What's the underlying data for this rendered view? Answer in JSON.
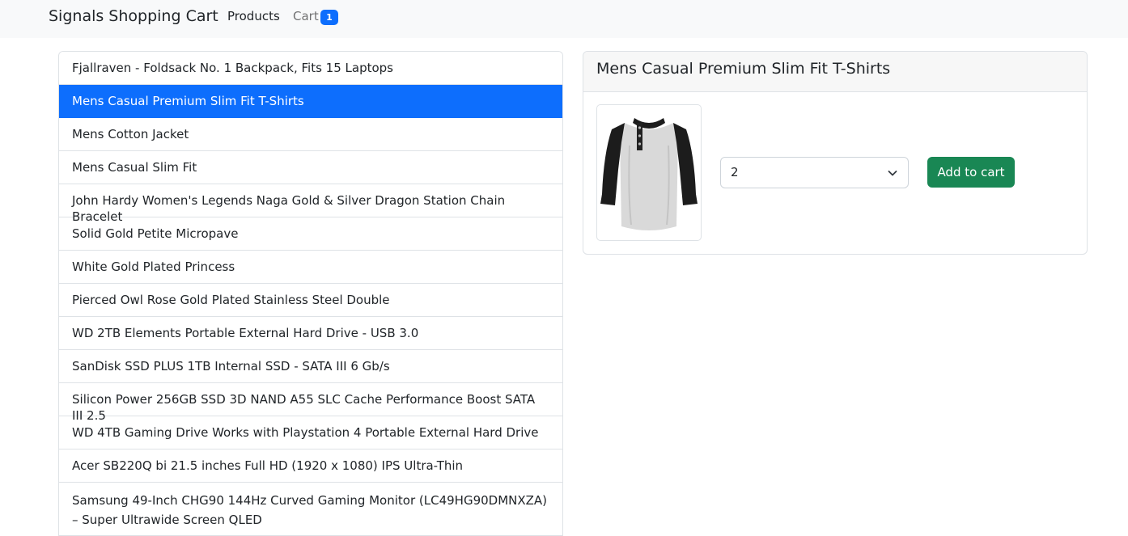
{
  "navbar": {
    "brand": "Signals Shopping Cart",
    "products_label": "Products",
    "cart_label": "Cart",
    "cart_count": "1"
  },
  "products": [
    {
      "title": "Fjallraven - Foldsack No. 1 Backpack, Fits 15 Laptops",
      "active": false
    },
    {
      "title": "Mens Casual Premium Slim Fit T-Shirts",
      "active": true
    },
    {
      "title": "Mens Cotton Jacket",
      "active": false
    },
    {
      "title": "Mens Casual Slim Fit",
      "active": false
    },
    {
      "title": "John Hardy Women's Legends Naga Gold & Silver Dragon Station Chain Bracelet",
      "active": false
    },
    {
      "title": "Solid Gold Petite Micropave",
      "active": false
    },
    {
      "title": "White Gold Plated Princess",
      "active": false
    },
    {
      "title": "Pierced Owl Rose Gold Plated Stainless Steel Double",
      "active": false
    },
    {
      "title": "WD 2TB Elements Portable External Hard Drive - USB 3.0",
      "active": false
    },
    {
      "title": "SanDisk SSD PLUS 1TB Internal SSD - SATA III 6 Gb/s",
      "active": false
    },
    {
      "title": "Silicon Power 256GB SSD 3D NAND A55 SLC Cache Performance Boost SATA III 2.5",
      "active": false
    },
    {
      "title": "WD 4TB Gaming Drive Works with Playstation 4 Portable External Hard Drive",
      "active": false
    },
    {
      "title": "Acer SB220Q bi 21.5 inches Full HD (1920 x 1080) IPS Ultra-Thin",
      "active": false
    },
    {
      "title": "Samsung 49-Inch CHG90 144Hz Curved Gaming Monitor (LC49HG90DMNXZA) – Super Ultrawide Screen QLED",
      "active": false
    }
  ],
  "detail": {
    "title": "Mens Casual Premium Slim Fit T-Shirts",
    "image_icon": "raglan-henley-shirt-image",
    "quantity": "2",
    "add_label": "Add to cart"
  },
  "colors": {
    "primary": "#0d6efd",
    "success": "#198754",
    "navbar_bg": "#f8f9fa"
  }
}
